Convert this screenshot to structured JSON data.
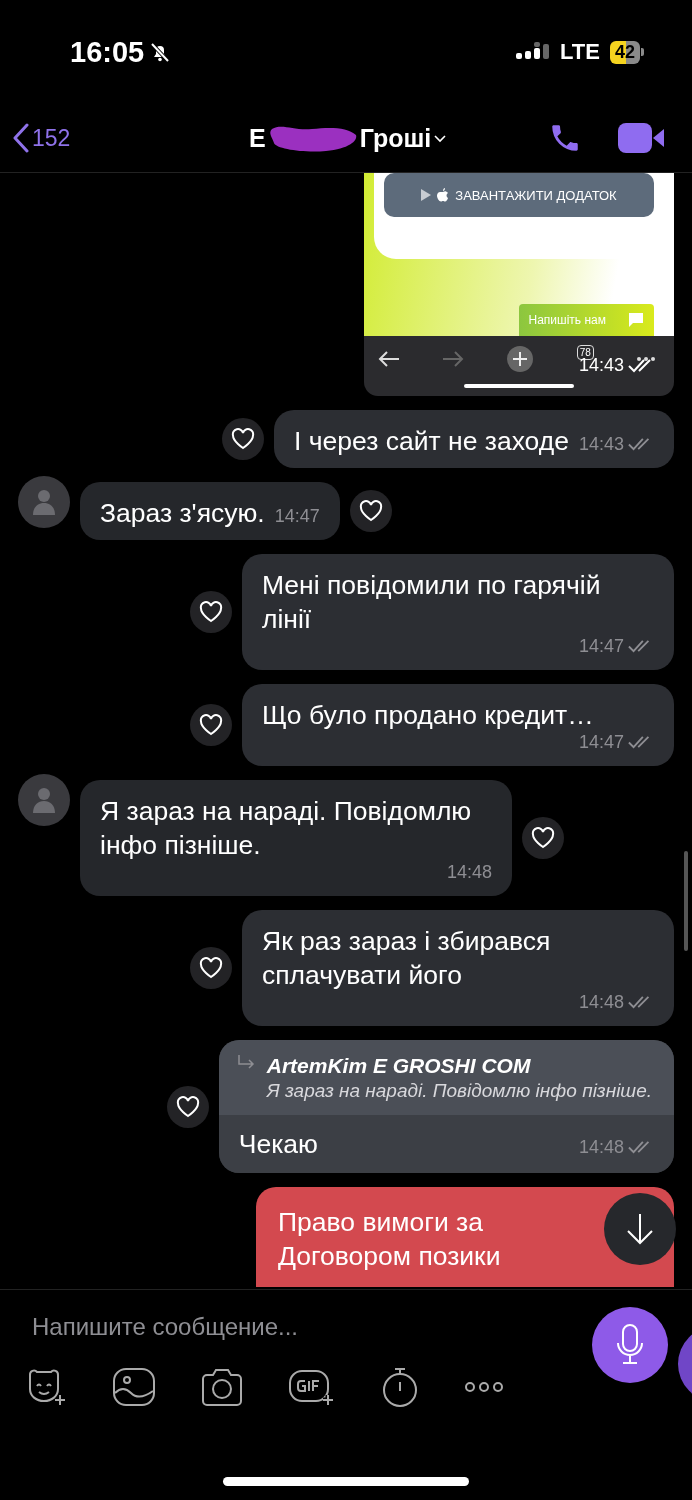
{
  "status_bar": {
    "time": "16:05",
    "network": "LTE",
    "battery": "42"
  },
  "header": {
    "back_count": "152",
    "title_start": "E",
    "title_end": "Гроші"
  },
  "messages": [
    {
      "kind": "screenshot",
      "outgoing": true,
      "button": "ЗАВАНТАЖИТИ ДОДАТОК",
      "chat_chip": "Напишіть нам",
      "tabs_count": "78",
      "time": "14:43"
    },
    {
      "kind": "text",
      "outgoing": true,
      "text": "І через сайт не заходе",
      "time": "14:43"
    },
    {
      "kind": "text",
      "outgoing": false,
      "text": "Зараз з'ясую.",
      "time": "14:47"
    },
    {
      "kind": "text",
      "outgoing": true,
      "text": "Мені повідомили по гарячій лінії",
      "time": "14:47"
    },
    {
      "kind": "text",
      "outgoing": true,
      "text": "Що було продано кредит…",
      "time": "14:47"
    },
    {
      "kind": "text",
      "outgoing": false,
      "text": "Я зараз на нараді. Повідомлю інфо пізніше.",
      "time": "14:48"
    },
    {
      "kind": "text",
      "outgoing": true,
      "text": "Як раз зараз і збирався сплачувати його",
      "time": "14:48"
    },
    {
      "kind": "reply",
      "outgoing": true,
      "quote_author": "ArtemKim E GROSHI COM",
      "quote_text": "Я зараз на нараді. Повідомлю інфо пізніше.",
      "text": "Чекаю",
      "time": "14:48"
    },
    {
      "kind": "alert",
      "outgoing": true,
      "text": "Право вимоги за Договором позики"
    }
  ],
  "composer": {
    "placeholder": "Напишите сообщение..."
  }
}
